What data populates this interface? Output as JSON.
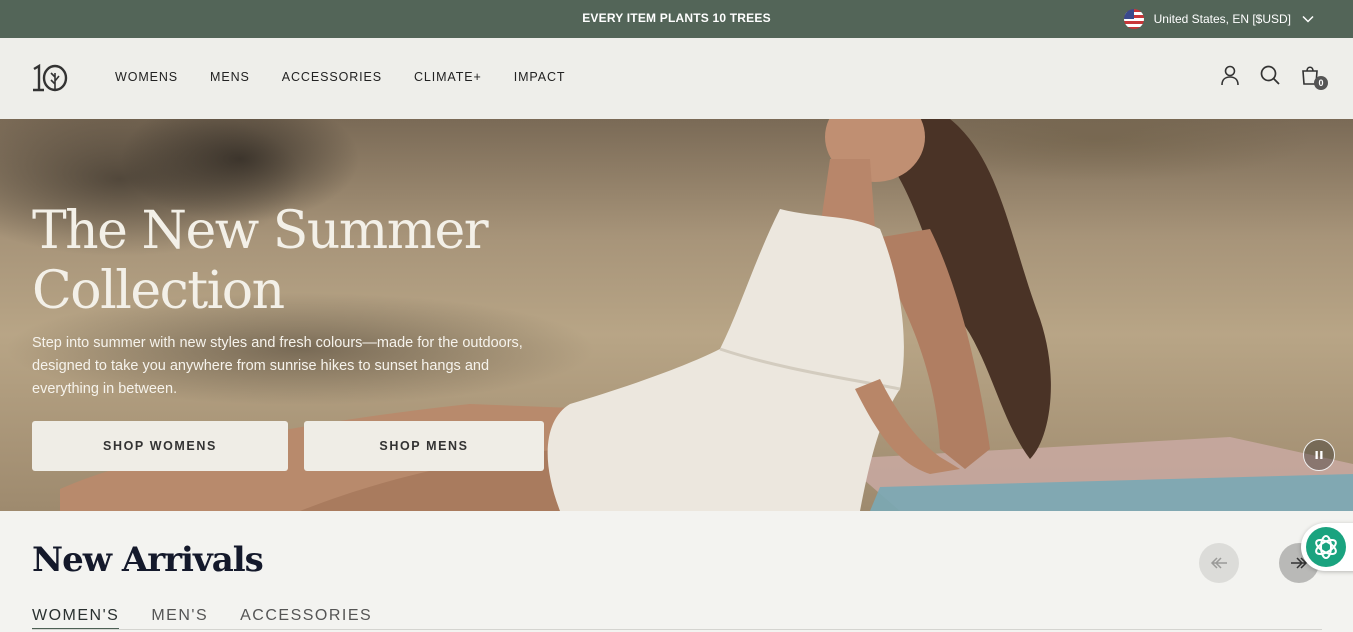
{
  "announcement": {
    "text": "EVERY ITEM PLANTS 10 TREES",
    "locale": "United States, EN [$USD]"
  },
  "header": {
    "logo_alt": "10",
    "nav": [
      "WOMENS",
      "MENS",
      "ACCESSORIES",
      "CLIMATE+",
      "IMPACT"
    ],
    "cart_count": "0"
  },
  "hero": {
    "title_line1": "The New Summer",
    "title_line2": "Collection",
    "subtitle": "Step into summer with new styles and fresh colours—made for the outdoors, designed to take you anywhere from sunrise hikes to sunset hangs and everything in between.",
    "btn_women": "SHOP WOMENS",
    "btn_men": "SHOP MENS"
  },
  "arrivals": {
    "title": "New Arrivals",
    "tabs": [
      "WOMEN'S",
      "MEN'S",
      "ACCESSORIES"
    ],
    "active_tab": "WOMEN'S"
  },
  "icons": [
    "flag-us-icon",
    "chevron-down-icon",
    "account-icon",
    "search-icon",
    "cart-icon",
    "pause-icon",
    "arrow-left-icon",
    "arrow-right-icon",
    "chatgpt-icon"
  ],
  "colors": {
    "announce_bg": "#536558",
    "header_bg": "#eeeeea",
    "accent": "#4d6054",
    "page_bg": "#f3f3f0"
  }
}
